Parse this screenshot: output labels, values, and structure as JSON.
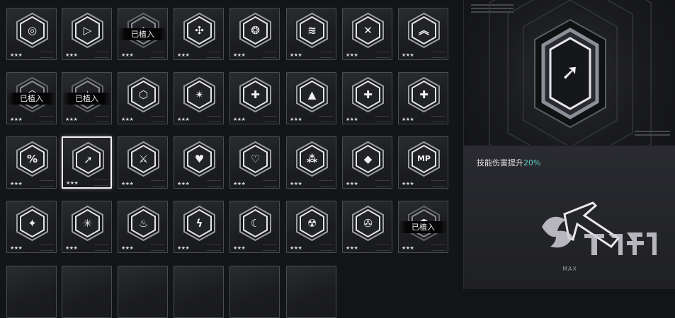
{
  "cards": [
    {
      "icon": "shield-target-icon",
      "stars": "★★★",
      "implanted": "",
      "selected": false
    },
    {
      "icon": "arrow-forward-icon",
      "stars": "★★★",
      "implanted": "",
      "selected": false
    },
    {
      "icon": "rhombus-icon",
      "stars": "★★★",
      "implanted": "已植入",
      "selected": false
    },
    {
      "icon": "diamond-knot-icon",
      "stars": "★★★",
      "implanted": "",
      "selected": false
    },
    {
      "icon": "triple-link-icon",
      "stars": "★★★",
      "implanted": "",
      "selected": false
    },
    {
      "icon": "wave-lines-icon",
      "stars": "★★★",
      "implanted": "",
      "selected": false
    },
    {
      "icon": "cross-chevrons-icon",
      "stars": "★★★",
      "implanted": "",
      "selected": false
    },
    {
      "icon": "up-chevrons-icon",
      "stars": "★★★",
      "implanted": "",
      "selected": false
    },
    {
      "icon": "hex-shield-icon",
      "stars": "★★★",
      "implanted": "已植入",
      "selected": false
    },
    {
      "icon": "star-shield-icon",
      "stars": "★★★",
      "implanted": "已植入",
      "selected": false
    },
    {
      "icon": "hex-shield-icon",
      "stars": "★★★",
      "implanted": "",
      "selected": false
    },
    {
      "icon": "star-burst-icon",
      "stars": "★★★",
      "implanted": "",
      "selected": false
    },
    {
      "icon": "diamond-plus-icon",
      "stars": "★★★",
      "implanted": "",
      "selected": false
    },
    {
      "icon": "circle-triangle-icon",
      "stars": "★★★",
      "implanted": "",
      "selected": false
    },
    {
      "icon": "shield-plus-icon",
      "stars": "★★★",
      "implanted": "",
      "selected": false
    },
    {
      "icon": "heavy-plus-icon",
      "stars": "★★★",
      "implanted": "",
      "selected": false
    },
    {
      "icon": "percent-icon",
      "stars": "★★★",
      "implanted": "",
      "selected": false
    },
    {
      "icon": "arrow-up-right-icon",
      "stars": "★★★",
      "implanted": "",
      "selected": true
    },
    {
      "icon": "crossed-swords-icon",
      "stars": "★★★",
      "implanted": "",
      "selected": false
    },
    {
      "icon": "heart-break-icon",
      "stars": "★★★",
      "implanted": "",
      "selected": false
    },
    {
      "icon": "heart-plus-icon",
      "stars": "★★★",
      "implanted": "",
      "selected": false
    },
    {
      "icon": "cluster-icon",
      "stars": "★★★",
      "implanted": "",
      "selected": false
    },
    {
      "icon": "gem-icon",
      "stars": "★★★",
      "implanted": "",
      "selected": false
    },
    {
      "icon": "mp-icon",
      "stars": "★★★",
      "implanted": "",
      "selected": false
    },
    {
      "icon": "compass-star-icon",
      "stars": "★★★",
      "implanted": "",
      "selected": false
    },
    {
      "icon": "snowflake-icon",
      "stars": "★★★",
      "implanted": "",
      "selected": false
    },
    {
      "icon": "flame-icon",
      "stars": "★★★",
      "implanted": "",
      "selected": false
    },
    {
      "icon": "lightning-icon",
      "stars": "★★★",
      "implanted": "",
      "selected": false
    },
    {
      "icon": "crescent-icon",
      "stars": "★★★",
      "implanted": "",
      "selected": false
    },
    {
      "icon": "radiation-icon",
      "stars": "★★★",
      "implanted": "",
      "selected": false
    },
    {
      "icon": "hazard-icon",
      "stars": "★★★",
      "implanted": "",
      "selected": false
    },
    {
      "icon": "hex-blank-icon",
      "stars": "★★★",
      "implanted": "已植入",
      "selected": false
    },
    {
      "icon": "",
      "stars": "",
      "implanted": "",
      "selected": false
    },
    {
      "icon": "",
      "stars": "",
      "implanted": "",
      "selected": false
    },
    {
      "icon": "",
      "stars": "",
      "implanted": "",
      "selected": false
    },
    {
      "icon": "",
      "stars": "",
      "implanted": "",
      "selected": false
    },
    {
      "icon": "",
      "stars": "",
      "implanted": "",
      "selected": false
    },
    {
      "icon": "",
      "stars": "",
      "implanted": "",
      "selected": false
    }
  ],
  "glyphs": {
    "shield-target-icon": "◎",
    "arrow-forward-icon": "▷",
    "rhombus-icon": "◆",
    "diamond-knot-icon": "✣",
    "triple-link-icon": "❂",
    "wave-lines-icon": "≋",
    "cross-chevrons-icon": "✕",
    "up-chevrons-icon": "︽",
    "hex-shield-icon": "⬡",
    "star-shield-icon": "✶",
    "star-burst-icon": "✴",
    "diamond-plus-icon": "✚",
    "circle-triangle-icon": "▲",
    "shield-plus-icon": "✚",
    "heavy-plus-icon": "✚",
    "percent-icon": "%",
    "arrow-up-right-icon": "➚",
    "crossed-swords-icon": "⚔",
    "heart-break-icon": "♥",
    "heart-plus-icon": "♡",
    "cluster-icon": "⁂",
    "gem-icon": "◆",
    "mp-icon": "MP",
    "compass-star-icon": "✦",
    "snowflake-icon": "✳",
    "flame-icon": "♨",
    "lightning-icon": "ϟ",
    "crescent-icon": "☾",
    "radiation-icon": "☢",
    "hazard-icon": "✇",
    "hex-blank-icon": "⬢"
  },
  "detail": {
    "icon": "arrow-up-right-icon",
    "effect_prefix": "技能伤害提升",
    "effect_value": "20%",
    "level": "MAX"
  }
}
